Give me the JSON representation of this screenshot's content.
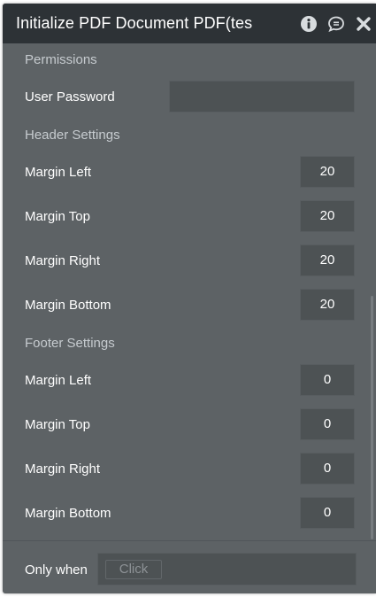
{
  "header": {
    "title": "Initialize PDF Document PDF(tes",
    "icons": [
      "info-icon",
      "comment-icon",
      "close-icon"
    ]
  },
  "permissions": {
    "section_label": "Permissions",
    "user_password_label": "User Password",
    "user_password_value": ""
  },
  "header_settings": {
    "section_label": "Header Settings",
    "fields": [
      {
        "label": "Margin Left",
        "value": "20"
      },
      {
        "label": "Margin Top",
        "value": "20"
      },
      {
        "label": "Margin Right",
        "value": "20"
      },
      {
        "label": "Margin Bottom",
        "value": "20"
      }
    ]
  },
  "footer_settings": {
    "section_label": "Footer Settings",
    "fields": [
      {
        "label": "Margin Left",
        "value": "0"
      },
      {
        "label": "Margin Top",
        "value": "0"
      },
      {
        "label": "Margin Right",
        "value": "0"
      },
      {
        "label": "Margin Bottom",
        "value": "0"
      }
    ]
  },
  "condition": {
    "label": "Only when",
    "placeholder": "Click"
  },
  "colors": {
    "panel_bg": "#5d6265",
    "titlebar_bg": "#2d3236",
    "input_bg": "#4d5254",
    "section_text": "#c6cbcf"
  }
}
